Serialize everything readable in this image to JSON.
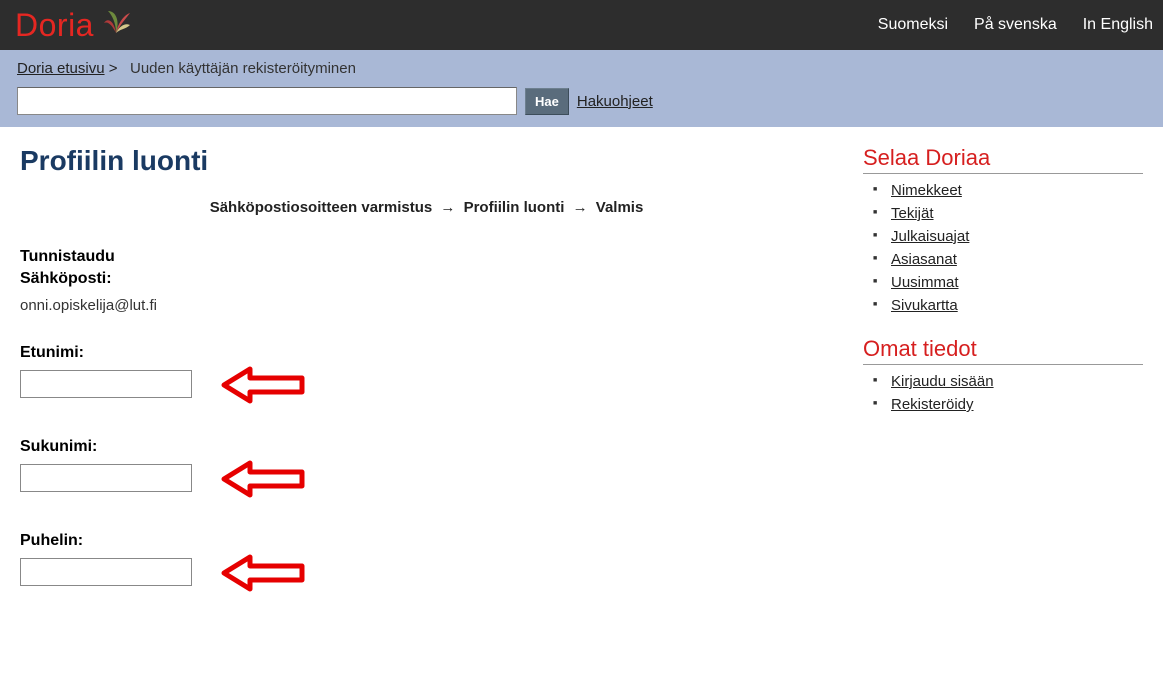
{
  "logo": "Doria",
  "lang": {
    "fi": "Suomeksi",
    "sv": "På svenska",
    "en": "In English"
  },
  "breadcrumb": {
    "home": "Doria etusivu",
    "sep": ">",
    "current": "Uuden käyttäjän rekisteröityminen"
  },
  "search": {
    "button": "Hae",
    "help": "Hakuohjeet",
    "value": ""
  },
  "page": {
    "title": "Profiilin luonti",
    "steps": {
      "s1": "Sähköpostiosoitteen varmistus",
      "s2": "Profiilin luonti",
      "s3": "Valmis",
      "arrow": "→"
    },
    "identify_label": "Tunnistaudu",
    "email_label": "Sähköposti:",
    "email_value": "onni.opiskelija@lut.fi",
    "fields": {
      "firstname": {
        "label": "Etunimi:",
        "value": ""
      },
      "lastname": {
        "label": "Sukunimi:",
        "value": ""
      },
      "phone": {
        "label": "Puhelin:",
        "value": ""
      }
    }
  },
  "sidebar": {
    "browse": {
      "title": "Selaa Doriaa",
      "items": [
        "Nimekkeet",
        "Tekijät",
        "Julkaisuajat",
        "Asiasanat",
        "Uusimmat",
        "Sivukartta"
      ]
    },
    "account": {
      "title": "Omat tiedot",
      "items": [
        "Kirjaudu sisään",
        "Rekisteröidy"
      ]
    }
  }
}
